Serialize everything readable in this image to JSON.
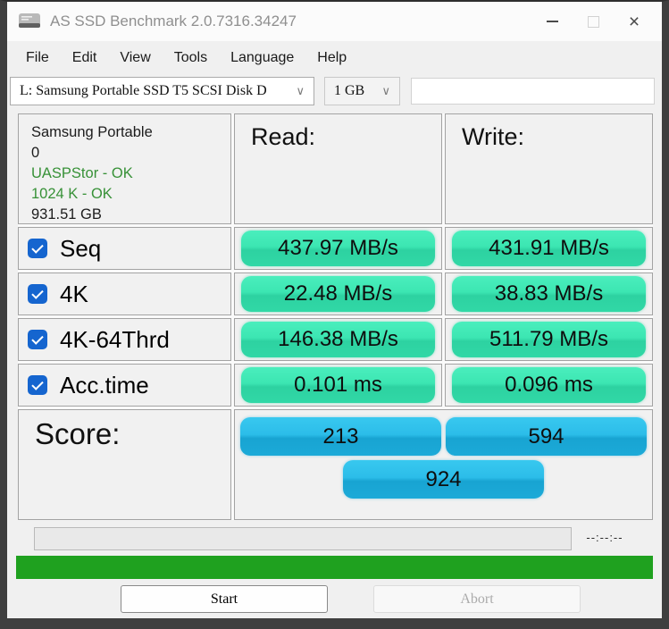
{
  "window": {
    "title": "AS SSD Benchmark 2.0.7316.34247"
  },
  "menu": {
    "items": [
      "File",
      "Edit",
      "View",
      "Tools",
      "Language",
      "Help"
    ]
  },
  "toolbar": {
    "drive_dropdown": {
      "value": "L: Samsung Portable SSD T5 SCSI Disk D",
      "chevron": "∨"
    },
    "size_dropdown": {
      "value": "1 GB",
      "chevron": "∨"
    },
    "text_field": {
      "value": ""
    }
  },
  "drive_info": {
    "name": "Samsung Portable",
    "number": "0",
    "driver_status": "UASPStor - OK",
    "alignment_status": "1024 K - OK",
    "capacity": "931.51 GB"
  },
  "table": {
    "read_header": "Read:",
    "write_header": "Write:",
    "tests": [
      {
        "label": "Seq",
        "checked": true,
        "read": "437.97 MB/s",
        "write": "431.91 MB/s"
      },
      {
        "label": "4K",
        "checked": true,
        "read": "22.48 MB/s",
        "write": "38.83 MB/s"
      },
      {
        "label": "4K-64Thrd",
        "checked": true,
        "read": "146.38 MB/s",
        "write": "511.79 MB/s"
      },
      {
        "label": "Acc.time",
        "checked": true,
        "read": "0.101 ms",
        "write": "0.096 ms"
      }
    ]
  },
  "score": {
    "label": "Score:",
    "read": "213",
    "write": "594",
    "total": "924"
  },
  "progress": {
    "time_remaining": "--:--:--"
  },
  "buttons": {
    "start": "Start",
    "abort": "Abort"
  },
  "colors": {
    "value_pill_green_top": "#3ce6b2",
    "value_pill_green_bottom": "#2dd2a1",
    "score_pill_blue_top": "#2cbde9",
    "score_pill_blue_bottom": "#18a4d2",
    "checkbox_blue": "#1565cf",
    "status_ok_green": "#379137",
    "status_bar_green": "#1fa11f",
    "title_text_gray": "#8f8f8f"
  }
}
